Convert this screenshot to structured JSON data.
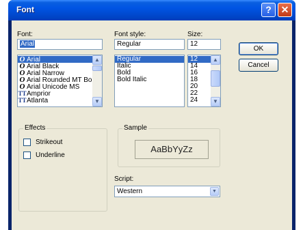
{
  "window": {
    "title": "Font"
  },
  "titlebar": {
    "help_glyph": "?",
    "close_glyph": "✕"
  },
  "font": {
    "label": "Font:",
    "value": "Arial",
    "items": [
      {
        "name": "Arial",
        "icon": "opentype-icon",
        "selected": true
      },
      {
        "name": "Arial Black",
        "icon": "opentype-icon",
        "selected": false
      },
      {
        "name": "Arial Narrow",
        "icon": "opentype-icon",
        "selected": false
      },
      {
        "name": "Arial Rounded MT Bol",
        "icon": "opentype-icon",
        "selected": false
      },
      {
        "name": "Arial Unicode MS",
        "icon": "opentype-icon",
        "selected": false
      },
      {
        "name": "Amprior",
        "icon": "truetype-icon",
        "selected": false
      },
      {
        "name": "Atlanta",
        "icon": "truetype-icon",
        "selected": false
      }
    ]
  },
  "style": {
    "label": "Font style:",
    "value": "Regular",
    "items": [
      "Regular",
      "Italic",
      "Bold",
      "Bold Italic"
    ]
  },
  "size": {
    "label": "Size:",
    "value": "12",
    "items": [
      "12",
      "14",
      "16",
      "18",
      "20",
      "22",
      "24"
    ]
  },
  "buttons": {
    "ok": "OK",
    "cancel": "Cancel"
  },
  "effects": {
    "legend": "Effects",
    "strikeout": "Strikeout",
    "underline": "Underline"
  },
  "sample": {
    "legend": "Sample",
    "text": "AaBbYyZz"
  },
  "script": {
    "label": "Script:",
    "value": "Western"
  }
}
